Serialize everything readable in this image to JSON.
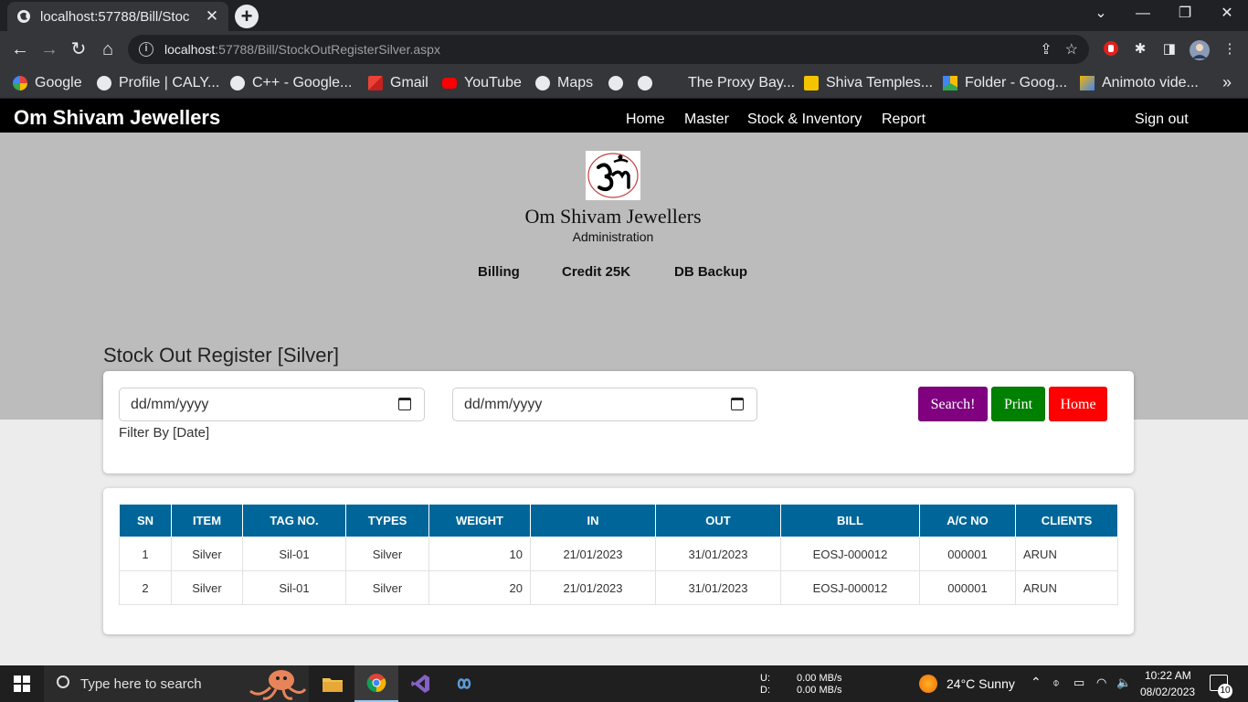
{
  "browser": {
    "tab_title": "localhost:57788/Bill/Stoc",
    "url_host": "localhost",
    "url_path": ":57788/Bill/StockOutRegisterSilver.aspx",
    "bookmarks": [
      {
        "label": "Google",
        "icon": "google-icon"
      },
      {
        "label": "Profile | CALY...",
        "icon": "globe-icon"
      },
      {
        "label": "C++ - Google...",
        "icon": "globe-icon"
      },
      {
        "label": "Gmail",
        "icon": "gmail-icon"
      },
      {
        "label": "YouTube",
        "icon": "youtube-icon"
      },
      {
        "label": "Maps",
        "icon": "globe-icon"
      },
      {
        "label": "The Proxy Bay...",
        "icon": "globe-icon"
      },
      {
        "label": "Shiva Temples...",
        "icon": "bookmark-icon"
      },
      {
        "label": "Folder - Goog...",
        "icon": "drive-icon"
      },
      {
        "label": "Animoto vide...",
        "icon": "animoto-icon"
      }
    ],
    "more_bookmarks": "»"
  },
  "site": {
    "brand": "Om Shivam Jewellers",
    "menu": [
      "Home",
      "Master",
      "Stock & Inventory",
      "Report"
    ],
    "signout": "Sign out",
    "hero_title": "Om Shivam Jewellers",
    "hero_subtitle": "Administration",
    "quick_links": [
      "Billing",
      "Credit 25K",
      "DB Backup"
    ]
  },
  "page": {
    "title": "Stock Out Register [Silver]",
    "from_date_placeholder": "dd/mm/yyyy",
    "to_date_placeholder": "dd/mm/yyyy",
    "filter_label": "Filter By [Date]",
    "buttons": {
      "search": "Search!",
      "print": "Print",
      "home": "Home"
    },
    "button_colors": {
      "search": "#800080",
      "print": "#008000",
      "home": "#ff0000"
    },
    "table": {
      "columns": [
        "SN",
        "ITEM",
        "TAG NO.",
        "TYPES",
        "WEIGHT",
        "IN",
        "OUT",
        "BILL",
        "A/C NO",
        "CLIENTS"
      ],
      "rows": [
        [
          "1",
          "Silver",
          "Sil-01",
          "Silver",
          "10",
          "21/01/2023",
          "31/01/2023",
          "EOSJ-000012",
          "000001",
          "ARUN"
        ],
        [
          "2",
          "Silver",
          "Sil-01",
          "Silver",
          "20",
          "21/01/2023",
          "31/01/2023",
          "EOSJ-000012",
          "000001",
          "ARUN"
        ]
      ],
      "header_color": "#006699"
    }
  },
  "taskbar": {
    "search_placeholder": "Type here to search",
    "net_up_label": "U:",
    "net_down_label": "D:",
    "net_up": "0.00 MB/s",
    "net_down": "0.00 MB/s",
    "weather": "24°C  Sunny",
    "time": "10:22 AM",
    "date": "08/02/2023",
    "notifications": "10"
  }
}
